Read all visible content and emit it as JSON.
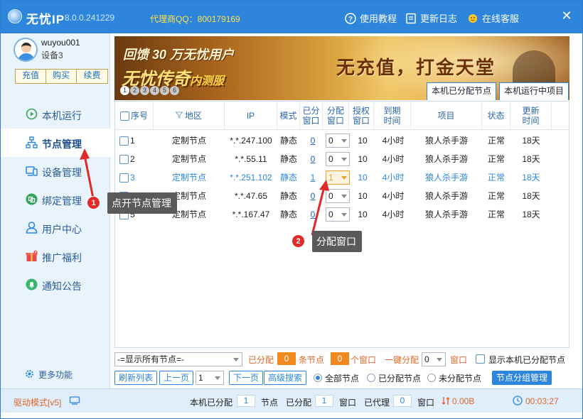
{
  "titlebar": {
    "app_name": "无忧IP",
    "version": "8.0.0.241229",
    "agent_qq": "代理商QQ：800179169",
    "tutorial": "使用教程",
    "changelog": "更新日志",
    "support": "在线客服",
    "close": "✕"
  },
  "user": {
    "username": "wuyou001",
    "device": "设备3",
    "buttons": [
      "充值",
      "购买",
      "续费"
    ]
  },
  "nav": [
    {
      "label": "本机运行",
      "icon": "play-circle-icon"
    },
    {
      "label": "节点管理",
      "icon": "node-tree-icon"
    },
    {
      "label": "设备管理",
      "icon": "device-icon"
    },
    {
      "label": "绑定管理",
      "icon": "bind-icon"
    },
    {
      "label": "用户中心",
      "icon": "user-icon"
    },
    {
      "label": "推广福利",
      "icon": "gift-icon"
    },
    {
      "label": "通知公告",
      "icon": "bell-icon"
    }
  ],
  "more_functions": "更多功能",
  "banner": {
    "line1": "回馈 30 万无忧用户",
    "line2_main": "无忧传奇",
    "line2_small": "内测服",
    "slogan": "无充值，打金天堂",
    "slides": [
      "1",
      "2",
      "3",
      "4",
      "5",
      "6"
    ],
    "tabs": [
      "本机已分配节点",
      "本机运行中项目"
    ]
  },
  "table": {
    "headers": {
      "index": "序号",
      "region": "地区",
      "ip": "IP",
      "mode": "模式",
      "assigned": "已分\n窗口",
      "alloc": "分配\n窗口",
      "auth": "授权\n窗口",
      "expiry": "到期\n时间",
      "project": "项目",
      "status": "状态",
      "renew": "更新\n时间"
    },
    "rows": [
      {
        "index": "1",
        "region": "定制节点",
        "ip": "*.*.247.100",
        "mode": "静态",
        "assigned": "0",
        "alloc": "0",
        "auth": "10",
        "expiry": "4小时",
        "project": "狼人杀手游",
        "status": "正常",
        "renew": "18天"
      },
      {
        "index": "2",
        "region": "定制节点",
        "ip": "*.*.55.11",
        "mode": "静态",
        "assigned": "0",
        "alloc": "0",
        "auth": "10",
        "expiry": "4小时",
        "project": "狼人杀手游",
        "status": "正常",
        "renew": "18天"
      },
      {
        "index": "3",
        "region": "定制节点",
        "ip": "*.*.251.102",
        "mode": "静态",
        "assigned": "1",
        "alloc": "1",
        "auth": "10",
        "expiry": "4小时",
        "project": "狼人杀手游",
        "status": "正常",
        "renew": "18天"
      },
      {
        "index": "4",
        "region": "定制节点",
        "ip": "*.*.47.65",
        "mode": "静态",
        "assigned": "0",
        "alloc": "0",
        "auth": "10",
        "expiry": "4小时",
        "project": "狼人杀手游",
        "status": "正常",
        "renew": "18天"
      },
      {
        "index": "5",
        "region": "定制节点",
        "ip": "*.*.167.47",
        "mode": "静态",
        "assigned": "0",
        "alloc": "0",
        "auth": "10",
        "expiry": "4小时",
        "project": "狼人杀手游",
        "status": "正常",
        "renew": "18天"
      }
    ]
  },
  "callouts": [
    {
      "num": "1",
      "text": "点开节点管理"
    },
    {
      "num": "2",
      "text": "分配窗口"
    }
  ],
  "filters": {
    "show_all": "-=显示所有节点=-",
    "assigned_label": "已分配",
    "assigned_nodes": "0",
    "nodes_unit": "条节点",
    "assigned_windows": "0",
    "windows_unit": "个窗口",
    "one_click": "一键分配",
    "one_click_value": "0",
    "window_word": "窗口",
    "show_local": "显示本机已分配节点"
  },
  "controls": {
    "refresh": "刷新列表",
    "prev": "上一页",
    "page": "1",
    "next": "下一页",
    "advanced": "高级搜索",
    "radios": [
      "全部节点",
      "已分配节点",
      "未分配节点"
    ],
    "group_mgmt": "节点分组管理"
  },
  "status": {
    "driver_mode": "驱动模式[v5]",
    "local_assigned": "本机已分配",
    "local_nodes": "1",
    "nodes": "节点",
    "assigned": "已分配",
    "assigned_count": "1",
    "window": "窗口",
    "proxied": "已代理",
    "proxied_count": "0",
    "window2": "窗口",
    "speed": "0.00B",
    "timer": "00:03:27"
  }
}
